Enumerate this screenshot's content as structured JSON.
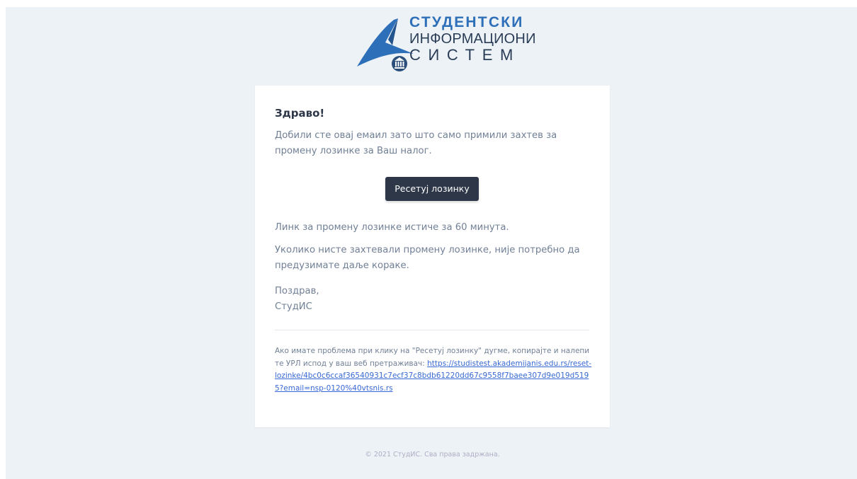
{
  "logo": {
    "line1": "СТУДЕНТСКИ",
    "line2": "ИНФОРМАЦИОНИ",
    "line3": "СИСТЕМ"
  },
  "email": {
    "greeting": "Здраво!",
    "intro": "Добили сте овај емаил зато што само примили захтев за промену лозинке за Ваш налог.",
    "button_label": "Ресетуј лозинку",
    "expiry": "Линк за промену лозинке истиче за 60 минута.",
    "ignore_note": "Уколико нисте захтевали промену лозинке, није потребно да предузимате даље кораке.",
    "salutation": "Поздрав,",
    "signature": "СтудИС",
    "subcopy_text": "Ако имате проблема при клику на \"Ресетуј лозинку\" дугме, копирајте и налепите УРЛ испод у ваш веб претраживач: ",
    "subcopy_link": "https://studistest.akademijanis.edu.rs/reset-lozinke/4bc0c6ccaf36540931c7ecf37c8bdb61220dd67c9558f7baee307d9e019d5195?email=nsp-0120%40vtsnis.rs"
  },
  "footer": {
    "copyright": "© 2021 СтудИС. Сва права задржана."
  },
  "colors": {
    "background": "#edf2f7",
    "button": "#2d3748",
    "link": "#3869d4",
    "logo_blue": "#2d6fb8"
  }
}
